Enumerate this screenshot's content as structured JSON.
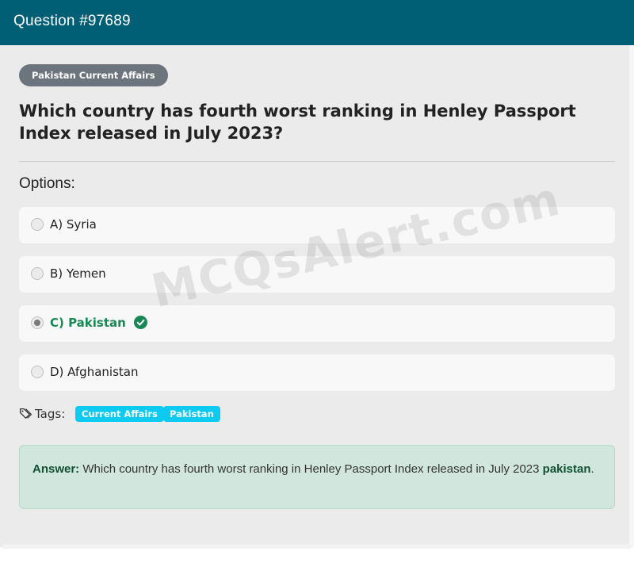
{
  "header": {
    "title": "Question #97689"
  },
  "category": "Pakistan Current Affairs",
  "question": "Which country has fourth worst ranking in Henley Passport Index released in July 2023?",
  "options_label": "Options:",
  "options": [
    {
      "label": "A) Syria",
      "selected": false,
      "correct": false
    },
    {
      "label": "B) Yemen",
      "selected": false,
      "correct": false
    },
    {
      "label": "C) Pakistan",
      "selected": true,
      "correct": true
    },
    {
      "label": "D) Afghanistan",
      "selected": false,
      "correct": false
    }
  ],
  "tags": {
    "label": "Tags:",
    "items": [
      "Current Affairs",
      "Pakistan"
    ]
  },
  "answer": {
    "prefix": "Answer:",
    "text": "Which country has fourth worst ranking in Henley Passport Index released in July 2023",
    "value": "pakistan",
    "suffix": "."
  },
  "watermark": "MCQsAlert.com",
  "colors": {
    "header": "#005f74",
    "correct": "#198754",
    "tag": "#0dcaf0",
    "category_badge": "#6c757d",
    "answer_bg": "#d1e7dd"
  }
}
